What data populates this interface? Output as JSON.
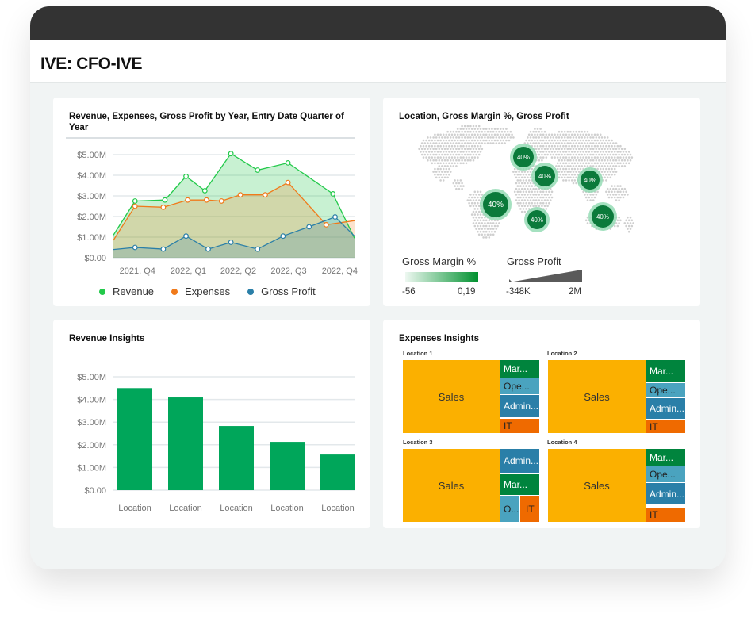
{
  "app": {
    "title": "IVE: CFO-IVE"
  },
  "colors": {
    "revenue": "#22c94a",
    "expenses": "#f07a1a",
    "gross_profit": "#2a7fa8",
    "bar": "#00a65a",
    "sales": "#fbb000",
    "marketing": "#00843d",
    "operations": "#4aa3bf",
    "admin": "#2a7fa8",
    "it": "#ef6a00",
    "map_dark": "#0b7a3b",
    "map_halo": "#8fd9b0"
  },
  "line_card": {
    "title": "Revenue, Expenses, Gross Profit by Year, Entry Date Quarter of Year",
    "chart_data": {
      "type": "area",
      "ylim": [
        0,
        5000000
      ],
      "yticks": [
        "$0.00",
        "$1.00M",
        "$2.00M",
        "$3.00M",
        "$4.00M",
        "$5.00M"
      ],
      "xlim": [
        "2021-08-23",
        "2022-11-01"
      ],
      "xticks": [
        {
          "label": "2021, Q4",
          "date": "2021-10-01"
        },
        {
          "label": "2022, Q1",
          "date": "2022-01-01"
        },
        {
          "label": "2022, Q2",
          "date": "2022-04-01"
        },
        {
          "label": "2022, Q3",
          "date": "2022-07-01"
        },
        {
          "label": "2022, Q4",
          "date": "2022-10-01"
        }
      ],
      "grid": true,
      "legend": "bottom",
      "series": [
        {
          "name": "Revenue",
          "color": "#22c94a",
          "points": [
            [
              "2021-08-23",
              1.1
            ],
            [
              "2021-10-01",
              2.75
            ],
            [
              "2021-11-24",
              2.8
            ],
            [
              "2022-01-01",
              3.95
            ],
            [
              "2022-02-04",
              3.25
            ],
            [
              "2022-03-23",
              5.05
            ],
            [
              "2022-05-10",
              4.25
            ],
            [
              "2022-07-04",
              4.6
            ],
            [
              "2022-09-23",
              3.1
            ],
            [
              "2022-11-01",
              0.95
            ]
          ]
        },
        {
          "name": "Expenses",
          "color": "#f07a1a",
          "points": [
            [
              "2021-08-23",
              0.85
            ],
            [
              "2021-10-01",
              2.5
            ],
            [
              "2021-11-21",
              2.45
            ],
            [
              "2022-01-04",
              2.8
            ],
            [
              "2022-02-07",
              2.8
            ],
            [
              "2022-03-06",
              2.75
            ],
            [
              "2022-04-09",
              3.05
            ],
            [
              "2022-05-24",
              3.05
            ],
            [
              "2022-07-04",
              3.65
            ],
            [
              "2022-09-11",
              1.6
            ],
            [
              "2022-11-01",
              1.8
            ]
          ]
        },
        {
          "name": "Gross Profit",
          "color": "#2a7fa8",
          "points": [
            [
              "2021-08-23",
              0.4
            ],
            [
              "2021-10-01",
              0.5
            ],
            [
              "2021-11-21",
              0.42
            ],
            [
              "2022-01-01",
              1.05
            ],
            [
              "2022-02-10",
              0.42
            ],
            [
              "2022-03-23",
              0.75
            ],
            [
              "2022-05-10",
              0.42
            ],
            [
              "2022-06-25",
              1.05
            ],
            [
              "2022-08-11",
              1.5
            ],
            [
              "2022-09-27",
              1.98
            ],
            [
              "2022-11-01",
              1.05
            ]
          ]
        }
      ],
      "value_unit": "$M"
    }
  },
  "map_card": {
    "title": "Location, Gross Margin %, Gross Profit",
    "bubble_label": "40%",
    "bubble_count": 6,
    "legend_margin": {
      "title": "Gross Margin %",
      "min": "-56",
      "max": "0,19"
    },
    "legend_profit": {
      "title": "Gross Profit",
      "min": "-348K",
      "max": "2M"
    }
  },
  "bar_card": {
    "title": "Revenue Insights",
    "chart_data": {
      "type": "bar",
      "categories": [
        "Location",
        "Location",
        "Location",
        "Location",
        "Location"
      ],
      "values": [
        4.5,
        4.09,
        2.83,
        2.13,
        1.57
      ],
      "value_unit": "$M",
      "ylim": [
        0,
        5
      ],
      "yticks": [
        "$0.00",
        "$1.00M",
        "$2.00M",
        "$3.00M",
        "$4.00M",
        "$5.00M"
      ],
      "grid": true
    }
  },
  "treemap_card": {
    "title": "Expenses Insights",
    "locations": [
      {
        "name": "Location 1",
        "cells": [
          "Sales",
          "Mar...",
          "Ope...",
          "Admin...",
          "IT"
        ]
      },
      {
        "name": "Location 2",
        "cells": [
          "Sales",
          "Mar...",
          "Ope...",
          "Admin...",
          "IT"
        ]
      },
      {
        "name": "Location 3",
        "cells": [
          "Sales",
          "Admin...",
          "Mar...",
          "O...",
          "IT"
        ]
      },
      {
        "name": "Location 4",
        "cells": [
          "Sales",
          "Mar...",
          "Ope...",
          "Admin...",
          "IT"
        ]
      }
    ]
  }
}
